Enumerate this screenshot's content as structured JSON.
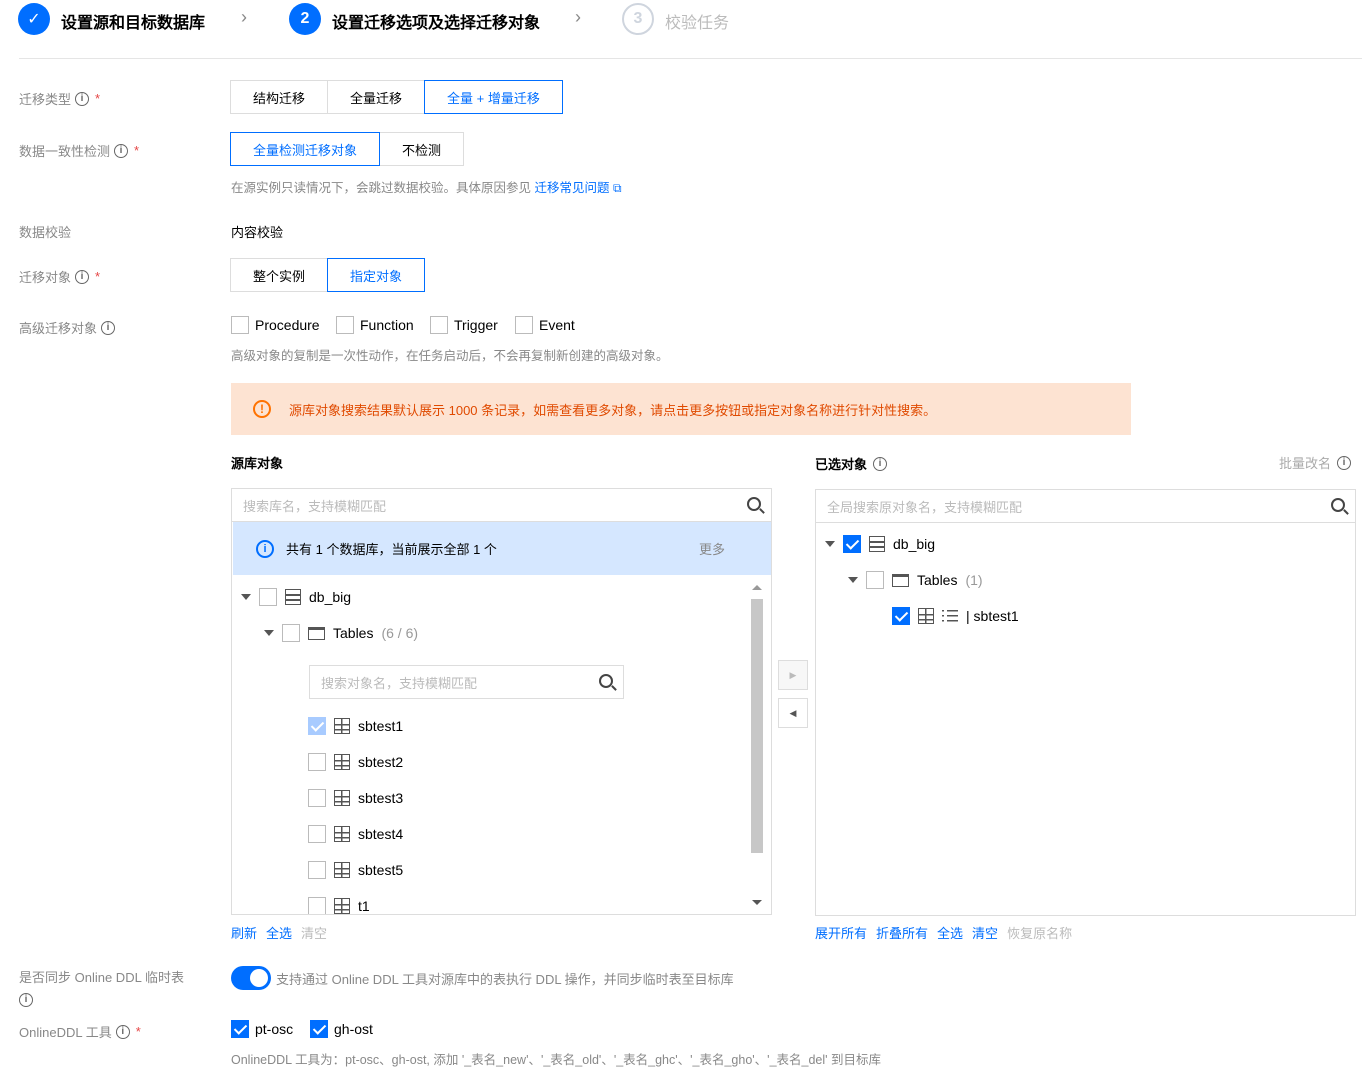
{
  "steps": [
    {
      "index": "✓",
      "label": "设置源和目标数据库",
      "state": "done"
    },
    {
      "index": "2",
      "label": "设置迁移选项及选择迁移对象",
      "state": "active"
    },
    {
      "index": "3",
      "label": "校验任务",
      "state": "todo"
    }
  ],
  "migration_type": {
    "label": "迁移类型",
    "options": [
      "结构迁移",
      "全量迁移",
      "全量 + 增量迁移"
    ],
    "selected": "全量 + 增量迁移"
  },
  "consistency_check": {
    "label": "数据一致性检测",
    "options": [
      "全量检测迁移对象",
      "不检测"
    ],
    "selected": "全量检测迁移对象",
    "hint": "在源实例只读情况下，会跳过数据校验。具体原因参见",
    "hint_link": "迁移常见问题"
  },
  "data_verification": {
    "label": "数据校验",
    "value": "内容校验"
  },
  "migration_object": {
    "label": "迁移对象",
    "options": [
      "整个实例",
      "指定对象"
    ],
    "selected": "指定对象"
  },
  "advanced_objects": {
    "label": "高级迁移对象",
    "options": [
      "Procedure",
      "Function",
      "Trigger",
      "Event"
    ],
    "hint": "高级对象的复制是一次性动作，在任务启动后，不会再复制新创建的高级对象。"
  },
  "warning": {
    "icon": "!",
    "text": "源库对象搜索结果默认展示 1000 条记录，如需查看更多对象，请点击更多按钮或指定对象名称进行针对性搜索。"
  },
  "source_panel": {
    "title": "源库对象",
    "search_placeholder": "搜索库名，支持模糊匹配",
    "info_text": "共有 1 个数据库，当前展示全部 1 个",
    "more": "更多",
    "db_name": "db_big",
    "tables_label": "Tables",
    "tables_count": "(6 / 6)",
    "table_search_placeholder": "搜索对象名，支持模糊匹配",
    "tables": [
      "sbtest1",
      "sbtest2",
      "sbtest3",
      "sbtest4",
      "sbtest5",
      "t1"
    ],
    "footer": [
      "刷新",
      "全选",
      "清空"
    ]
  },
  "selected_panel": {
    "title": "已选对象",
    "rename": "批量改名",
    "search_placeholder": "全局搜索原对象名，支持模糊匹配",
    "db_name": "db_big",
    "tables_label": "Tables",
    "tables_count": "(1)",
    "table_name": "| sbtest1",
    "footer": [
      "展开所有",
      "折叠所有",
      "全选",
      "清空",
      "恢复原名称"
    ]
  },
  "online_ddl": {
    "label": "是否同步 Online DDL 临时表",
    "toggle_text": "支持通过 Online DDL 工具对源库中的表执行 DDL 操作，并同步临时表至目标库",
    "tool_label": "OnlineDDL 工具",
    "tools": [
      "pt-osc",
      "gh-ost"
    ],
    "hint": "OnlineDDL 工具为：pt-osc、gh-ost, 添加 '_表名_new'、'_表名_old'、'_表名_ghc'、'_表名_gho'、'_表名_del' 到目标库"
  }
}
